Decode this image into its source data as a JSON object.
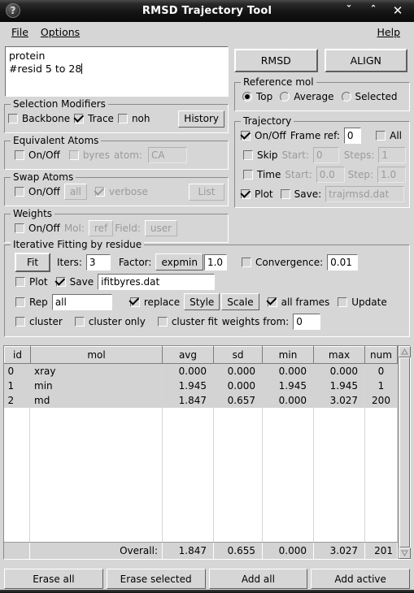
{
  "window": {
    "title": "RMSD Trajectory Tool",
    "help_icon": "question-mark-icon",
    "minimize": "ˇ",
    "maximize": "ˆ",
    "close": "✕"
  },
  "menubar": {
    "file": "File",
    "options": "Options",
    "help": "Help"
  },
  "selection": {
    "line1": "protein",
    "line2": "#resid 5 to 28"
  },
  "selection_modifiers": {
    "title": "Selection Modifiers",
    "backbone": {
      "label": "Backbone",
      "checked": false
    },
    "trace": {
      "label": "Trace",
      "checked": true
    },
    "noh": {
      "label": "noh",
      "checked": false
    },
    "history_button": "History"
  },
  "equivalent_atoms": {
    "title": "Equivalent Atoms",
    "onoff": {
      "label": "On/Off",
      "checked": false
    },
    "byres": {
      "label": "byres",
      "checked": false,
      "disabled": true
    },
    "atom_label": "atom:",
    "atom_value": "CA"
  },
  "swap_atoms": {
    "title": "Swap Atoms",
    "onoff": {
      "label": "On/Off",
      "checked": false
    },
    "all_button": "all",
    "verbose": {
      "label": "verbose",
      "checked": true,
      "disabled": true
    },
    "list_button": "List"
  },
  "weights": {
    "title": "Weights",
    "onoff": {
      "label": "On/Off",
      "checked": false
    },
    "mol_label": "Mol:",
    "mol_value": "ref",
    "field_label": "Field:",
    "field_value": "user"
  },
  "actions": {
    "rmsd": "RMSD",
    "align": "ALIGN"
  },
  "reference_mol": {
    "title": "Reference mol",
    "options": [
      {
        "label": "Top",
        "selected": true
      },
      {
        "label": "Average",
        "selected": false
      },
      {
        "label": "Selected",
        "selected": false
      }
    ]
  },
  "trajectory": {
    "title": "Trajectory",
    "onoff": {
      "label": "On/Off",
      "checked": true
    },
    "frame_ref_label": "Frame ref:",
    "frame_ref_value": "0",
    "all": {
      "label": "All",
      "checked": false
    },
    "skip": {
      "label": "Skip",
      "checked": false
    },
    "skip_start_label": "Start:",
    "skip_start_value": "0",
    "skip_steps_label": "Steps:",
    "skip_steps_value": "1",
    "time": {
      "label": "Time",
      "checked": false
    },
    "time_start_label": "Start:",
    "time_start_value": "0.0",
    "time_step_label": "Step:",
    "time_step_value": "1.0",
    "plot": {
      "label": "Plot",
      "checked": true
    },
    "save": {
      "label": "Save:",
      "checked": false
    },
    "save_value": "trajrmsd.dat"
  },
  "iterative_fitting": {
    "title": "Iterative Fitting by residue",
    "fit_button": "Fit",
    "iters_label": "Iters:",
    "iters_value": "3",
    "factor_label": "Factor:",
    "factor_value": "expmin",
    "factor_number": "1.0",
    "convergence": {
      "label": "Convergence:",
      "checked": false
    },
    "convergence_value": "0.01",
    "plot": {
      "label": "Plot",
      "checked": false
    },
    "save": {
      "label": "Save",
      "checked": true
    },
    "save_value": "ifitbyres.dat",
    "rep": {
      "label": "Rep",
      "checked": false
    },
    "rep_value": "all",
    "replace": {
      "label": "replace",
      "checked": true
    },
    "style_button": "Style",
    "scale_button": "Scale",
    "all_frames": {
      "label": "all frames",
      "checked": true
    },
    "update": {
      "label": "Update",
      "checked": false
    },
    "cluster": {
      "label": "cluster",
      "checked": false
    },
    "cluster_only": {
      "label": "cluster only",
      "checked": false
    },
    "cluster_fit": {
      "label": "cluster fit",
      "checked": false
    },
    "weights_from_label": "weights from:",
    "weights_from_value": "0"
  },
  "table": {
    "columns": [
      "id",
      "mol",
      "avg",
      "sd",
      "min",
      "max",
      "num"
    ],
    "rows": [
      {
        "id": "0",
        "mol": "xray",
        "avg": "0.000",
        "sd": "0.000",
        "min": "0.000",
        "max": "0.000",
        "num": "0"
      },
      {
        "id": "1",
        "mol": "min",
        "avg": "1.945",
        "sd": "0.000",
        "min": "1.945",
        "max": "1.945",
        "num": "1"
      },
      {
        "id": "2",
        "mol": "md",
        "avg": "1.847",
        "sd": "0.657",
        "min": "0.000",
        "max": "3.027",
        "num": "200"
      }
    ],
    "overall": {
      "label": "Overall:",
      "avg": "1.847",
      "sd": "0.655",
      "min": "0.000",
      "max": "3.027",
      "num": "201"
    }
  },
  "bottom_buttons": {
    "erase_all": "Erase all",
    "erase_selected": "Erase selected",
    "add_all": "Add all",
    "add_active": "Add active"
  }
}
